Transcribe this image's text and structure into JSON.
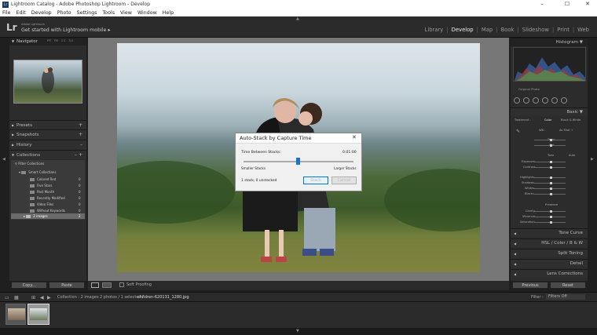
{
  "window": {
    "title": "Lightroom Catalog - Adobe Photoshop Lightroom - Develop",
    "minimize": "–",
    "maximize": "☐",
    "close": "✕"
  },
  "menu": [
    "File",
    "Edit",
    "Develop",
    "Photo",
    "Settings",
    "Tools",
    "View",
    "Window",
    "Help"
  ],
  "identity": {
    "logo": "Lr",
    "line1": "Adobe Lightroom",
    "line2": "Get started with Lightroom mobile ▸"
  },
  "modules": [
    "Library",
    "Develop",
    "Map",
    "Book",
    "Slideshow",
    "Print",
    "Web"
  ],
  "active_module": "Develop",
  "left": {
    "navigator": "Navigator",
    "nav_opts": [
      "FIT",
      "Fill",
      "1:1",
      "3:1"
    ],
    "presets": "Presets",
    "snapshots": "Snapshots",
    "history": "History",
    "collections": "Collections",
    "plus": "+",
    "minus": "–",
    "filter": "Filter Collections",
    "smart": "Smart Collections",
    "smart_items": [
      {
        "name": "Colored Red",
        "count": "0"
      },
      {
        "name": "Five Stars",
        "count": "0"
      },
      {
        "name": "Past Month",
        "count": "0"
      },
      {
        "name": "Recently Modified",
        "count": "0"
      },
      {
        "name": "Video Files",
        "count": "0"
      },
      {
        "name": "Without Keywords",
        "count": "0"
      }
    ],
    "selected_collection": {
      "name": "2 images",
      "count": "2"
    },
    "copy": "Copy...",
    "paste": "Paste"
  },
  "dialog": {
    "title": "Auto-Stack by Capture Time",
    "close": "✕",
    "label": "Time Between Stacks:",
    "value": "0:01:00",
    "slider_position": 0.49,
    "smaller": "Smaller Stacks",
    "larger": "Larger Stacks",
    "status": "1 stack, 0 unstacked",
    "stack": "Stack",
    "cancel": "Cancel"
  },
  "right": {
    "histogram": "Histogram",
    "original": "Original Photo",
    "basic": "Basic",
    "treatment": "Treatment :",
    "color": "Color",
    "bw": "Black & White",
    "wb": "WB :",
    "as_shot": "As Shot ÷",
    "temp": "Temp",
    "tint": "Tint",
    "tone": "Tone",
    "auto": "Auto",
    "exposure": "Exposure",
    "contrast": "Contrast",
    "highlights": "Highlights",
    "shadows": "Shadows",
    "whites": "Whites",
    "blacks": "Blacks",
    "presence": "Presence",
    "clarity": "Clarity",
    "vibrance": "Vibrance",
    "saturation": "Saturation",
    "tone_curve": "Tone Curve",
    "hsl": "HSL  /  Color  /  B & W",
    "split": "Split Toning",
    "detail": "Detail",
    "lens": "Lens Corrections",
    "previous": "Previous",
    "reset": "Reset"
  },
  "toolbar": {
    "soft_proofing": "Soft Proofing"
  },
  "filmstrip": {
    "collection": "Collection : 2 images",
    "selected_count": "2 photos / 1 selected /",
    "filename": "children-620131_1280.jpg",
    "filter": "Filter :",
    "filter_value": "Filters Off"
  },
  "colors": {
    "accent": "#1a75d2",
    "panel": "#2c2c2c",
    "center_bg": "#777777"
  }
}
